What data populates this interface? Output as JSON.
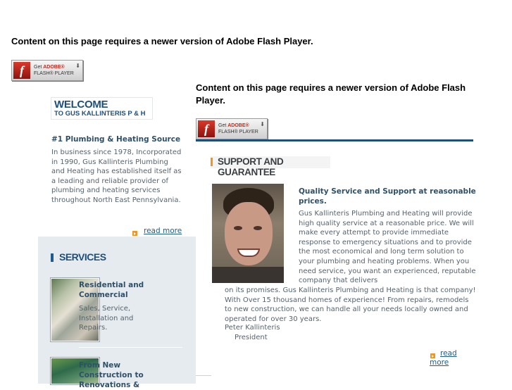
{
  "flash": {
    "message": "Content on this page requires a newer version of Adobe Flash Player.",
    "badge_line1_prefix": "Get ",
    "badge_line1_brand": "ADOBE®",
    "badge_line2": "FLASH® PLAYER",
    "icon": "adobe-flash-icon"
  },
  "welcome": {
    "title": "WELCOME",
    "subtitle": "TO GUS KALLINTERIS P & H",
    "heading": "#1 Plumbing & Heating Source",
    "body": "In business since 1978, Incorporated in 1990, Gus Kallinteris Plumbing and Heating has established itself as a leading and reliable provider of plumbing and heating services throughout North East Pennsylvania.",
    "read_more": "read more"
  },
  "services": {
    "title": "SERVICES",
    "items": [
      {
        "title": "Residential and Commercial",
        "desc": "Sales, Service, Installation and Repairs."
      },
      {
        "title": "From New Construction to Renovations &",
        "desc": ""
      }
    ]
  },
  "support": {
    "title": "SUPPORT AND GUARANTEE",
    "heading": "Quality Service and Support at reasonable prices.",
    "body_top": "Gus Kallinteris Plumbing and Heating will provide high quality service at a reasonable price. We will make every attempt to provide immediate response to emergency situations and to provide the most economical and long term solution to your plumbing and heating problems. When you need service, you want an experienced, reputable company that delivers",
    "body_wrap": "on its promises. Gus Kallinteris Plumbing and Heating is that company! With Over 15 thousand homes of experience! From repairs, remodels to new construction, we can handle all your needs locally owned and operated for over 30 years.",
    "signer_name": "Peter Kallinteris",
    "signer_role": "President",
    "read_more_1": "read",
    "read_more_2": "more"
  },
  "colors": {
    "brand_blue": "#1e4f7c",
    "accent_orange": "#f29322",
    "panel_bg": "#e6ebef"
  }
}
